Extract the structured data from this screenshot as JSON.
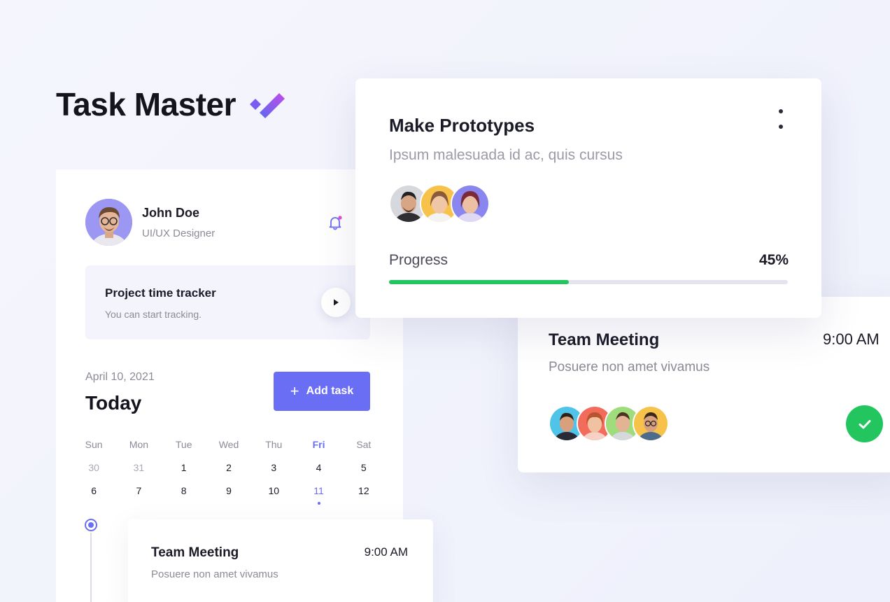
{
  "brand": {
    "title": "Task Master"
  },
  "profile": {
    "name": "John Doe",
    "role": "UI/UX Designer"
  },
  "tracker": {
    "title": "Project time tracker",
    "subtitle": "You can start tracking."
  },
  "schedule": {
    "date": "April 10, 2021",
    "heading": "Today",
    "add_label": "Add task",
    "weekdays": [
      "Sun",
      "Mon",
      "Tue",
      "Wed",
      "Thu",
      "Fri",
      "Sat"
    ],
    "active_weekday": "Fri",
    "week1": [
      "30",
      "31",
      "1",
      "2",
      "3",
      "4",
      "5"
    ],
    "week2": [
      "6",
      "7",
      "8",
      "9",
      "10",
      "11",
      "12"
    ],
    "selected_day": "11"
  },
  "meeting_small": {
    "title": "Team Meeting",
    "time": "9:00 AM",
    "subtitle": "Posuere non amet vivamus"
  },
  "meeting_big": {
    "title": "Team Meeting",
    "time": "9:00 AM",
    "subtitle": "Posuere non amet vivamus"
  },
  "prototype": {
    "title": "Make Prototypes",
    "subtitle": "Ipsum malesuada id ac, quis cursus",
    "progress_label": "Progress",
    "progress_text": "45%",
    "progress": 0.45
  },
  "colors": {
    "accent": "#6a6ef4",
    "success": "#22c55e",
    "track": "#e4e5ec"
  },
  "icons": [
    "checkmark-logo-icon",
    "bell-icon",
    "play-icon",
    "plus-icon",
    "more-vertical-icon",
    "check-icon"
  ]
}
